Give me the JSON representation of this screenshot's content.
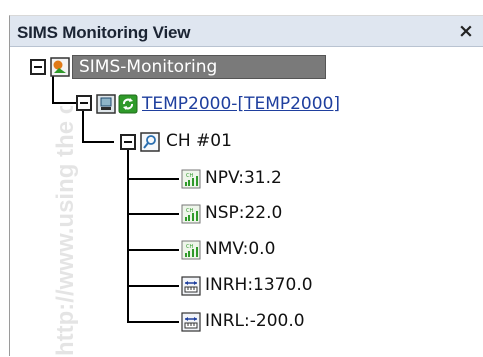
{
  "window": {
    "title": "SIMS Monitoring View",
    "close_glyph": "×"
  },
  "watermark": {
    "text": "http://www.using the con"
  },
  "tree": {
    "root": {
      "label": "SIMS-Monitoring",
      "icon": "monitoring-root-icon"
    },
    "device": {
      "label": "TEMP2000-[TEMP2000]",
      "icons": [
        "device-icon",
        "refresh-icon"
      ]
    },
    "channel": {
      "label": "CH #01",
      "icon": "channel-search-icon"
    },
    "items": [
      {
        "label": "NPV:31.2",
        "icon": "signal-bars-icon"
      },
      {
        "label": "NSP:22.0",
        "icon": "signal-bars-icon"
      },
      {
        "label": "NMV:0.0",
        "icon": "signal-bars-icon"
      },
      {
        "label": "INRH:1370.0",
        "icon": "range-icon"
      },
      {
        "label": "INRL:-200.0",
        "icon": "range-icon"
      }
    ]
  },
  "colors": {
    "titlebar_bg": "#dfe6f0",
    "root_label_bg": "#7a7a7a",
    "link": "#1f3f9e",
    "green_icon": "#2f9a2a",
    "orange_icon": "#e07a18"
  }
}
